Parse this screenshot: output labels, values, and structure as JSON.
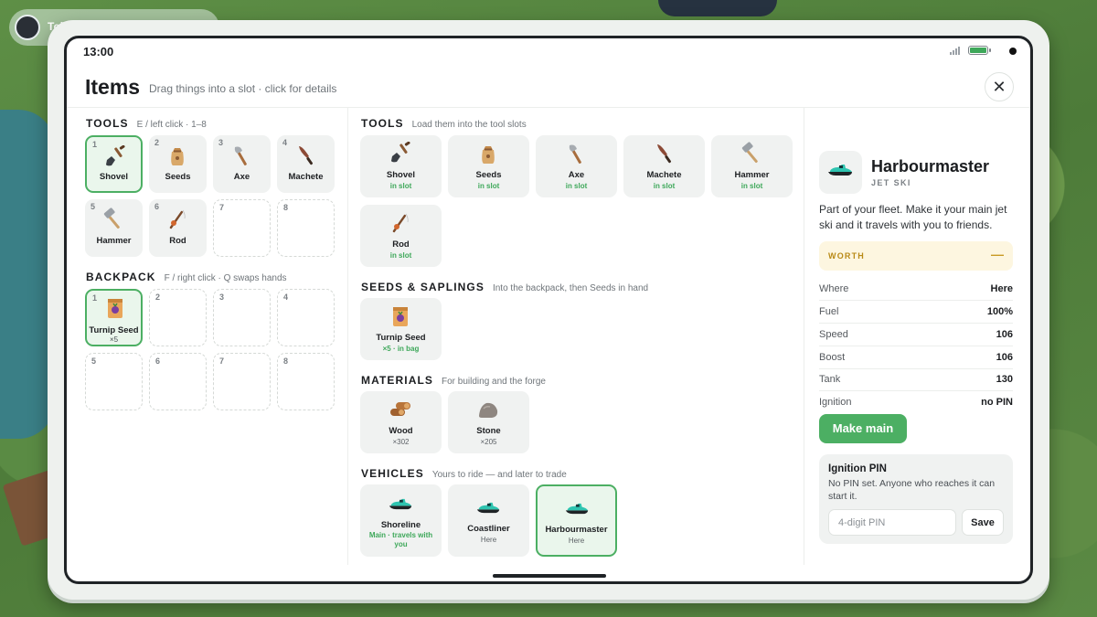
{
  "background": {
    "player_name": "Tol"
  },
  "status_bar": {
    "time": "13:00"
  },
  "header": {
    "title": "Items",
    "subtitle": "Drag things into a slot · click for details",
    "close_symbol": "✕"
  },
  "left": {
    "tools": {
      "title": "TOOLS",
      "hint": "E / left click · 1–8",
      "slots": [
        {
          "num": "1",
          "label": "Shovel",
          "icon": "shovel-icon"
        },
        {
          "num": "2",
          "label": "Seeds",
          "icon": "seed-bag-icon"
        },
        {
          "num": "3",
          "label": "Axe",
          "icon": "axe-icon"
        },
        {
          "num": "4",
          "label": "Machete",
          "icon": "machete-icon"
        },
        {
          "num": "5",
          "label": "Hammer",
          "icon": "hammer-icon"
        },
        {
          "num": "6",
          "label": "Rod",
          "icon": "fishing-rod-icon"
        },
        {
          "num": "7"
        },
        {
          "num": "8"
        }
      ]
    },
    "backpack": {
      "title": "BACKPACK",
      "hint": "F / right click · Q swaps hands",
      "slots": [
        {
          "num": "1",
          "label": "Turnip Seed",
          "count": "×5",
          "icon": "turnip-seed-packet-icon"
        },
        {
          "num": "2"
        },
        {
          "num": "3"
        },
        {
          "num": "4"
        },
        {
          "num": "5"
        },
        {
          "num": "6"
        },
        {
          "num": "7"
        },
        {
          "num": "8"
        }
      ]
    }
  },
  "middle": {
    "tools": {
      "title": "TOOLS",
      "hint": "Load them into the tool slots",
      "items": [
        {
          "label": "Shovel",
          "status": "in slot"
        },
        {
          "label": "Seeds",
          "status": "in slot"
        },
        {
          "label": "Axe",
          "status": "in slot"
        },
        {
          "label": "Machete",
          "status": "in slot"
        },
        {
          "label": "Hammer",
          "status": "in slot"
        },
        {
          "label": "Rod",
          "status": "in slot"
        }
      ]
    },
    "seeds": {
      "title": "SEEDS & SAPLINGS",
      "hint": "Into the backpack, then Seeds in hand",
      "items": [
        {
          "label": "Turnip Seed",
          "status": "×5 · in bag"
        }
      ]
    },
    "materials": {
      "title": "MATERIALS",
      "hint": "For building and the forge",
      "items": [
        {
          "label": "Wood",
          "status": "×302"
        },
        {
          "label": "Stone",
          "status": "×205"
        }
      ]
    },
    "vehicles": {
      "title": "VEHICLES",
      "hint": "Yours to ride — and later to trade",
      "items": [
        {
          "label": "Shoreline",
          "status": "Main · travels with you"
        },
        {
          "label": "Coastliner",
          "status": "Here"
        },
        {
          "label": "Harbourmaster",
          "status": "Here"
        }
      ]
    }
  },
  "detail": {
    "name": "Harbourmaster",
    "type": "JET SKI",
    "description": "Part of your fleet. Make it your main jet ski and it travels with you to friends.",
    "worth_label": "WORTH",
    "worth_value": "—",
    "stats": [
      {
        "key": "Where",
        "value": "Here"
      },
      {
        "key": "Fuel",
        "value": "100%"
      },
      {
        "key": "Speed",
        "value": "106"
      },
      {
        "key": "Boost",
        "value": "106"
      },
      {
        "key": "Tank",
        "value": "130"
      },
      {
        "key": "Ignition",
        "value": "no PIN"
      }
    ],
    "make_main_label": "Make main",
    "pin": {
      "title": "Ignition PIN",
      "text": "No PIN set. Anyone who reaches it can start it.",
      "placeholder": "4-digit PIN",
      "save_label": "Save"
    }
  },
  "colors": {
    "accent_green": "#4caf63",
    "status_green": "#3ea85a",
    "worth_gold": "#b98a17",
    "worth_bg": "#fdf6e0"
  }
}
